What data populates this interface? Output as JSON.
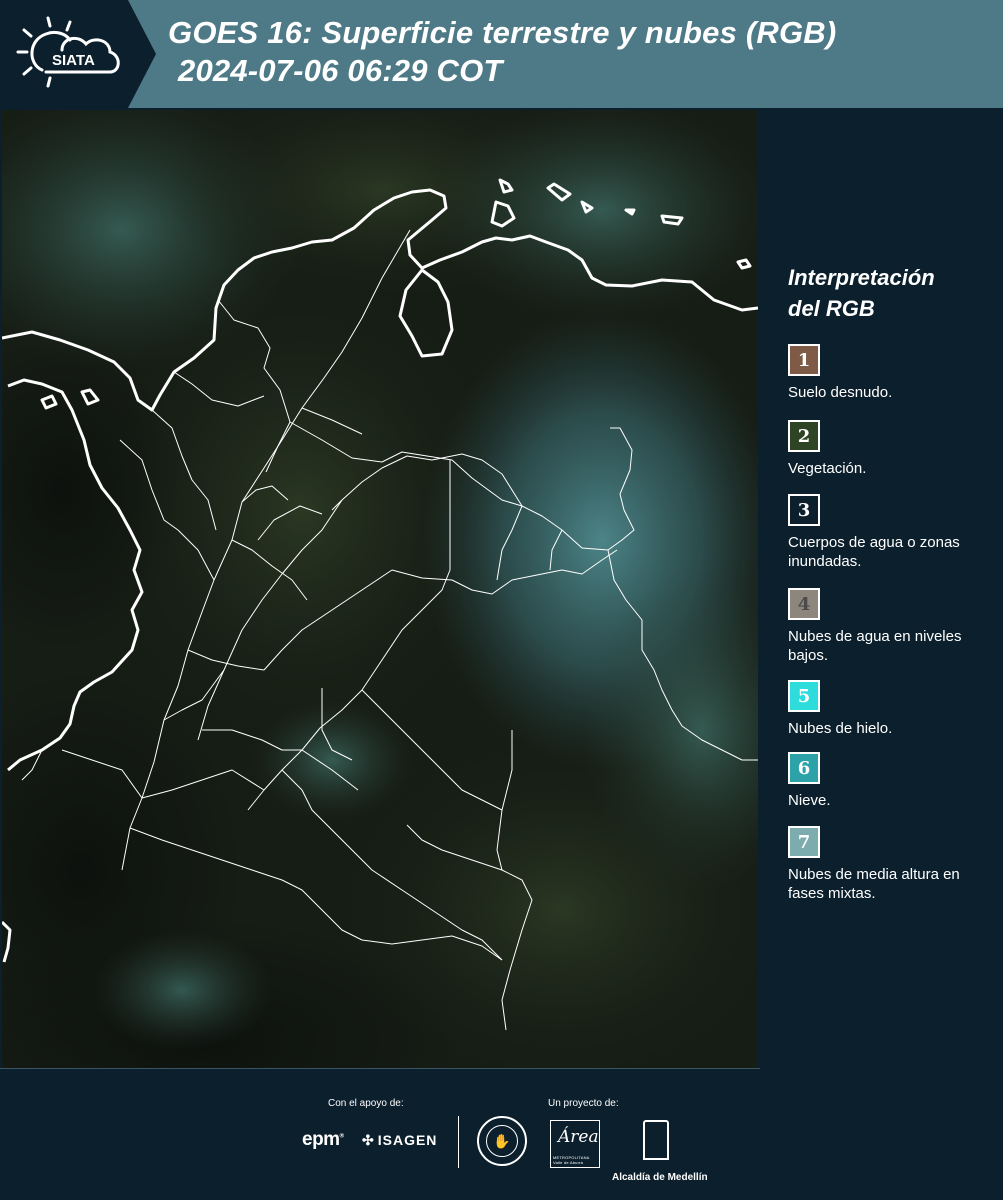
{
  "header": {
    "logo_text": "SIATA",
    "title_line1": "GOES 16: Superficie terrestre y nubes (RGB)",
    "title_line2": "2024-07-06 06:29 COT"
  },
  "legend": {
    "title_line1": "Interpretación",
    "title_line2": "del RGB",
    "items": [
      {
        "number": "1",
        "label": "Suelo desnudo.",
        "color": "#7e5a47",
        "number_color": "#ffffff"
      },
      {
        "number": "2",
        "label": "Vegetación.",
        "color": "#2e4424",
        "number_color": "#ffffff"
      },
      {
        "number": "3",
        "label": "Cuerpos de agua o zonas inundadas.",
        "color": "#0c1f2c",
        "number_color": "#ffffff"
      },
      {
        "number": "4",
        "label": "Nubes de agua en niveles bajos.",
        "color": "#8c867c",
        "number_color": "#4a4a4a"
      },
      {
        "number": "5",
        "label": "Nubes de hielo.",
        "color": "#2fdcdc",
        "number_color": "#ffffff"
      },
      {
        "number": "6",
        "label": "Nieve.",
        "color": "#2ba3a9",
        "number_color": "#ffffff"
      },
      {
        "number": "7",
        "label": "Nubes de media altura en fases mixtas.",
        "color": "#7cacad",
        "number_color": "#ffffff"
      }
    ]
  },
  "footer": {
    "support_label": "Con el apoyo de:",
    "project_label": "Un proyecto de:",
    "sponsors": [
      "epm",
      "ISAGEN"
    ],
    "partners": [
      "Área Metropolitana Valle de Aburrá",
      "Alcaldía de Medellín"
    ],
    "epm_text": "epm",
    "isagen_text": "ISAGEN",
    "area_word": "Área",
    "area_sub": "METROPOLITANA Valle de Aburrá",
    "alcaldia_text": "Alcaldía de Medellín"
  },
  "colors": {
    "header_bg": "#4e7a88",
    "panel_bg": "#0c1f2c",
    "boundary_line": "#ffffff"
  }
}
